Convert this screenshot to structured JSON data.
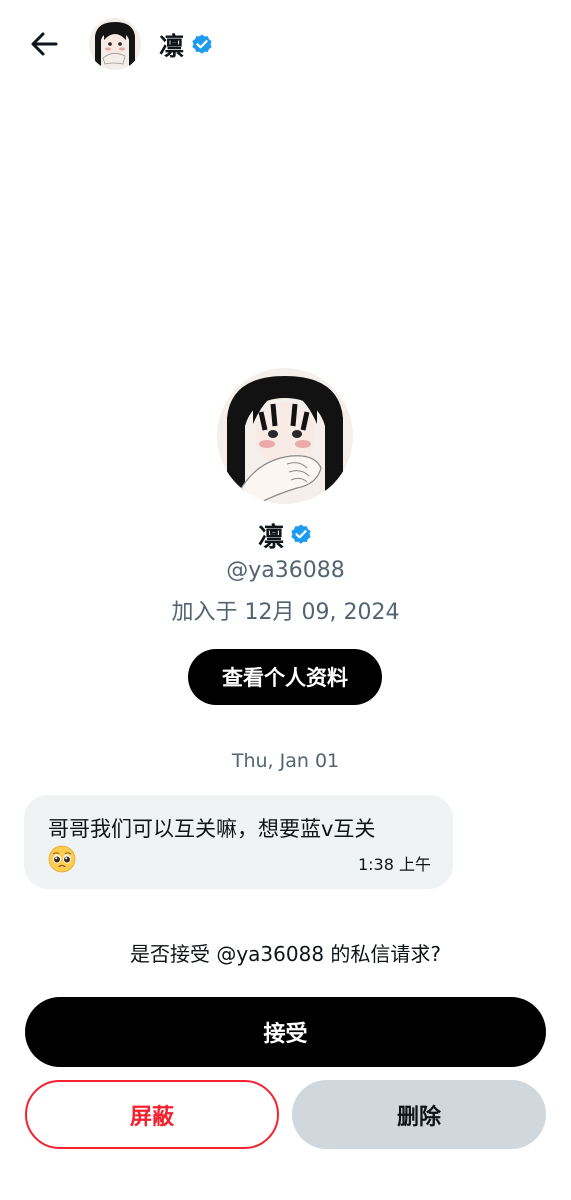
{
  "colors": {
    "accent": "#1d9bf0",
    "danger": "#f4212e",
    "muted_text": "#536471",
    "bubble_bg": "#eff3f4",
    "secondary_button_bg": "#d0d8de",
    "primary_button_bg": "#000000"
  },
  "header": {
    "back_icon": "arrow-left-icon",
    "name": "凛",
    "verified_icon": "verified-badge-icon"
  },
  "profile": {
    "name": "凛",
    "handle": "@ya36088",
    "joined": "加入于 12月 09, 2024",
    "view_profile_label": "查看个人资料"
  },
  "conversation": {
    "date_separator": "Thu, Jan 01",
    "messages": [
      {
        "text": "哥哥我们可以互关嘛，想要蓝v互关",
        "emoji": "pleading-face-emoji",
        "time": "1:38 上午"
      }
    ]
  },
  "request": {
    "prompt": "是否接受 @ya36088 的私信请求?",
    "accept_label": "接受",
    "block_label": "屏蔽",
    "delete_label": "删除"
  }
}
